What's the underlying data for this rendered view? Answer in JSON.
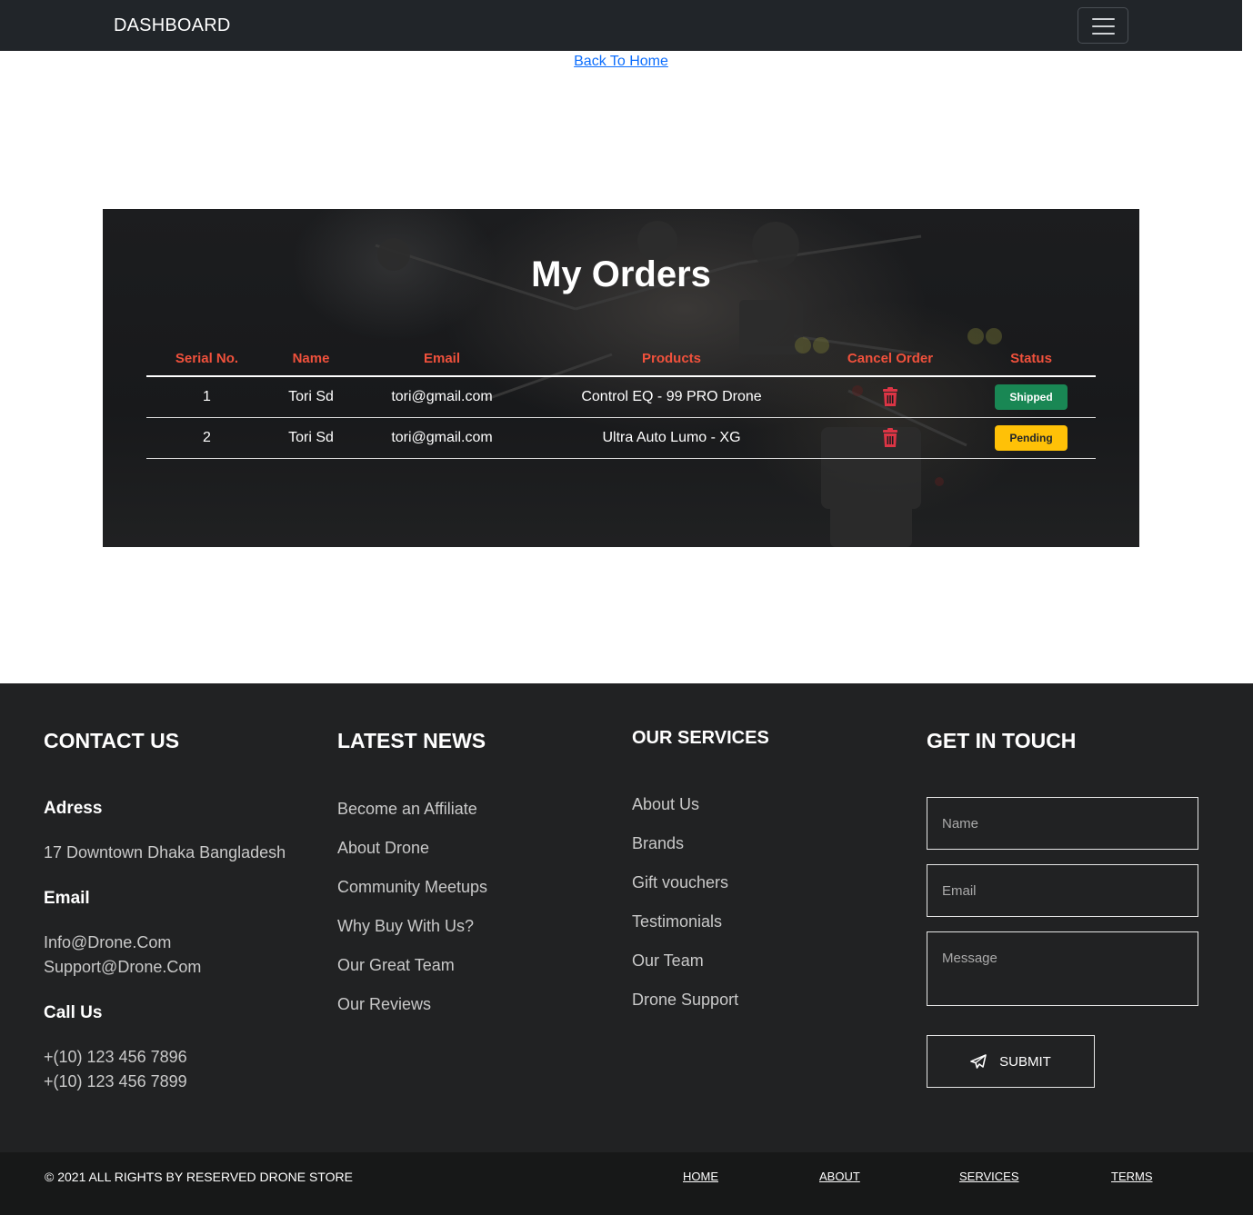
{
  "navbar": {
    "brand": "DASHBOARD",
    "menu_icon": "hamburger-icon"
  },
  "back_link": "Back To Home",
  "orders": {
    "title": "My Orders",
    "columns": [
      "Serial No.",
      "Name",
      "Email",
      "Products",
      "Cancel Order",
      "Status"
    ],
    "rows": [
      {
        "serial": "1",
        "name": "Tori Sd",
        "email": "tori@gmail.com",
        "product": "Control EQ - 99 PRO Drone",
        "cancel_icon": "trash-icon",
        "status": "Shipped"
      },
      {
        "serial": "2",
        "name": "Tori Sd",
        "email": "tori@gmail.com",
        "product": "Ultra Auto Lumo - XG",
        "cancel_icon": "trash-icon",
        "status": "Pending"
      }
    ],
    "colors": {
      "header_text": "#f0513c",
      "shipped": "#198754",
      "pending": "#ffc107",
      "trash": "#dc3545"
    }
  },
  "footer": {
    "contact": {
      "title": "CONTACT US",
      "address_label": "Adress",
      "address": "17 Downtown Dhaka Bangladesh",
      "email_label": "Email",
      "emails": [
        "Info@Drone.Com",
        "Support@Drone.Com"
      ],
      "call_label": "Call Us",
      "phones": [
        "+(10) 123 456 7896",
        "+(10) 123 456 7899"
      ]
    },
    "news": {
      "title": "LATEST NEWS",
      "items": [
        "Become an Affiliate",
        "About Drone",
        "Community Meetups",
        "Why Buy With Us?",
        "Our Great Team",
        "Our Reviews"
      ]
    },
    "services": {
      "title": "OUR SERVICES",
      "items": [
        "About Us",
        "Brands",
        "Gift vouchers",
        "Testimonials",
        "Our Team",
        "Drone Support"
      ]
    },
    "touch": {
      "title": "GET IN TOUCH",
      "name_placeholder": "Name",
      "email_placeholder": "Email",
      "message_placeholder": "Message",
      "submit_label": "SUBMIT",
      "submit_icon": "paper-plane-icon"
    }
  },
  "bottom_bar": {
    "copyright": "© 2021 ALL RIGHTS BY RESERVED DRONE STORE",
    "links": [
      "HOME",
      "ABOUT",
      "SERVICES",
      "TERMS"
    ]
  }
}
